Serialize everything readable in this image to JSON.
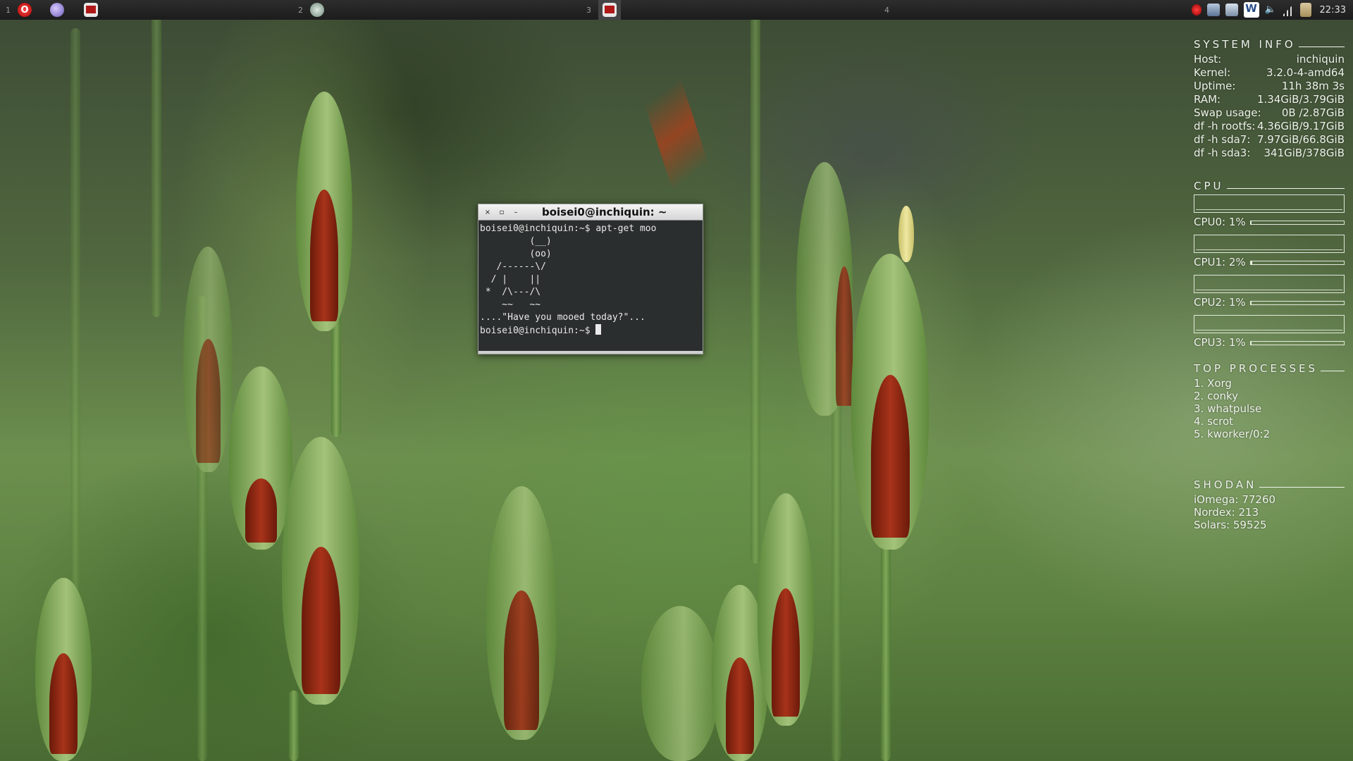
{
  "panel": {
    "workspaces": [
      {
        "num": "1"
      },
      {
        "num": "2"
      },
      {
        "num": "3"
      },
      {
        "num": "4"
      }
    ],
    "clock": "22:33"
  },
  "terminal": {
    "title": "boisei0@inchiquin: ~",
    "buttons": {
      "close": "×",
      "maximize": "▫",
      "minimize": "–"
    },
    "lines": [
      "boisei0@inchiquin:~$ apt-get moo",
      "         (__)",
      "         (oo)",
      "   /------\\/",
      "  / |    ||",
      " *  /\\---/\\",
      "    ~~   ~~",
      "....\"Have you mooed today?\"...",
      "boisei0@inchiquin:~$ "
    ]
  },
  "conky": {
    "system": {
      "title": "SYSTEM INFO",
      "rows": [
        {
          "key": "Host:",
          "value": "inchiquin"
        },
        {
          "key": "Kernel:",
          "value": "3.2.0-4-amd64"
        },
        {
          "key": "Uptime:",
          "value": "11h 38m 3s"
        },
        {
          "key": "RAM:",
          "value": "1.34GiB/3.79GiB"
        },
        {
          "key": "Swap usage:",
          "value": "0B  /2.87GiB"
        },
        {
          "key": "df -h rootfs:",
          "value": "4.36GiB/9.17GiB"
        },
        {
          "key": "df -h sda7:",
          "value": "7.97GiB/66.8GiB"
        },
        {
          "key": "df -h sda3:",
          "value": "341GiB/378GiB"
        }
      ]
    },
    "cpu": {
      "title": "CPU",
      "cores": [
        {
          "label": "CPU0: 1%",
          "usage": 1
        },
        {
          "label": "CPU1: 2%",
          "usage": 2
        },
        {
          "label": "CPU2: 1%",
          "usage": 1
        },
        {
          "label": "CPU3: 1%",
          "usage": 1
        }
      ]
    },
    "top": {
      "title": "TOP PROCESSES",
      "items": [
        "1. Xorg",
        "2. conky",
        "3. whatpulse",
        "4. scrot",
        "5. kworker/0:2"
      ]
    },
    "shodan": {
      "title": "SHODAN",
      "items": [
        "iOmega: 77260",
        "Nordex: 213",
        "Solars: 59525"
      ]
    }
  }
}
